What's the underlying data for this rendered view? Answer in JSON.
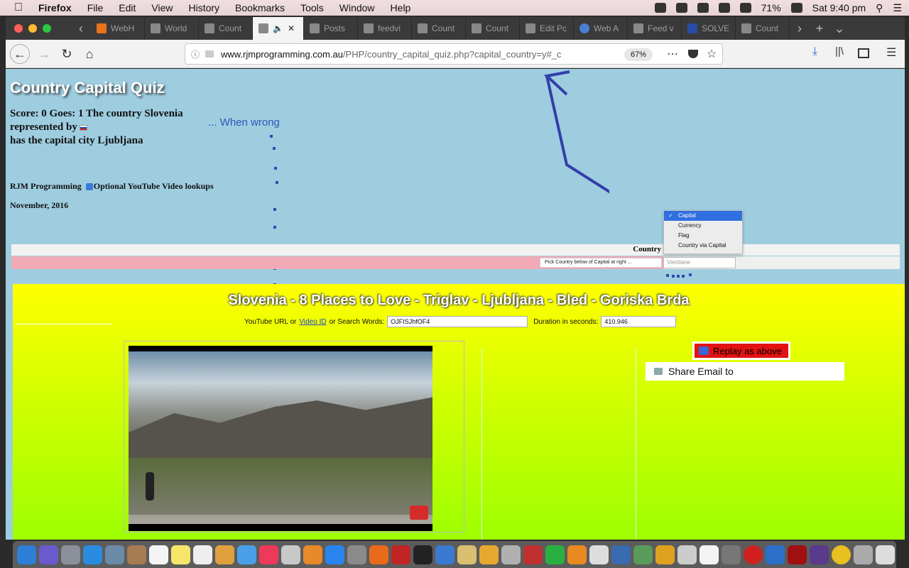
{
  "menubar": {
    "app": "Firefox",
    "items": [
      "File",
      "Edit",
      "View",
      "History",
      "Bookmarks",
      "Tools",
      "Window",
      "Help"
    ],
    "battery": "71%",
    "clock": "Sat 9:40 pm"
  },
  "tabs": [
    {
      "label": "WebH",
      "icon": "cpanel-icon"
    },
    {
      "label": "World",
      "icon": "page-icon"
    },
    {
      "label": "Count",
      "icon": "page-icon"
    },
    {
      "label": "",
      "icon": "page-icon",
      "active": true
    },
    {
      "label": "Posts",
      "icon": "page-icon"
    },
    {
      "label": "feedvi",
      "icon": "page-icon"
    },
    {
      "label": "Count",
      "icon": "page-icon"
    },
    {
      "label": "Count",
      "icon": "page-icon"
    },
    {
      "label": "Edit Pc",
      "icon": "edit-icon"
    },
    {
      "label": "Web A",
      "icon": "globe-icon"
    },
    {
      "label": "Feed v",
      "icon": "page-icon"
    },
    {
      "label": "SOLVE",
      "icon": "page-icon"
    },
    {
      "label": "Count",
      "icon": "page-icon"
    }
  ],
  "navbar": {
    "url_host": "www.rjmprogramming.com.au",
    "url_path": "/PHP/country_capital_quiz.php?capital_country=y#_c",
    "zoom": "67%"
  },
  "quiz": {
    "title": "Country Capital Quiz",
    "score_line1": "Score: 0 Goes: 1 The country Slovenia",
    "score_line2": "represented by",
    "score_line3": "has the capital city Ljubljana",
    "when_wrong": "... When wrong",
    "rjm": "RJM Programming",
    "youtube_opt": "Optional YouTube Video lookups",
    "date": "November, 2016",
    "table_header": "Country",
    "pick_select": "Pick Country below of Capital at right ...",
    "capital_placeholder": "Vientiane",
    "dropdown": [
      "Capital",
      "Currency",
      "Flag",
      "Country via Capital"
    ]
  },
  "video": {
    "title": "Slovenia - 8 Places to Love - Triglav - Ljubljana - Bled - Goriska Brda",
    "yt_label1": "YouTube URL or",
    "yt_link": "Video ID",
    "yt_label2": "or Search Words:",
    "yt_value": "OJFISJhfOF4",
    "duration_label": "Duration in seconds:",
    "duration_value": "410.946",
    "replay": "Replay as above",
    "share": "Share Email to"
  }
}
